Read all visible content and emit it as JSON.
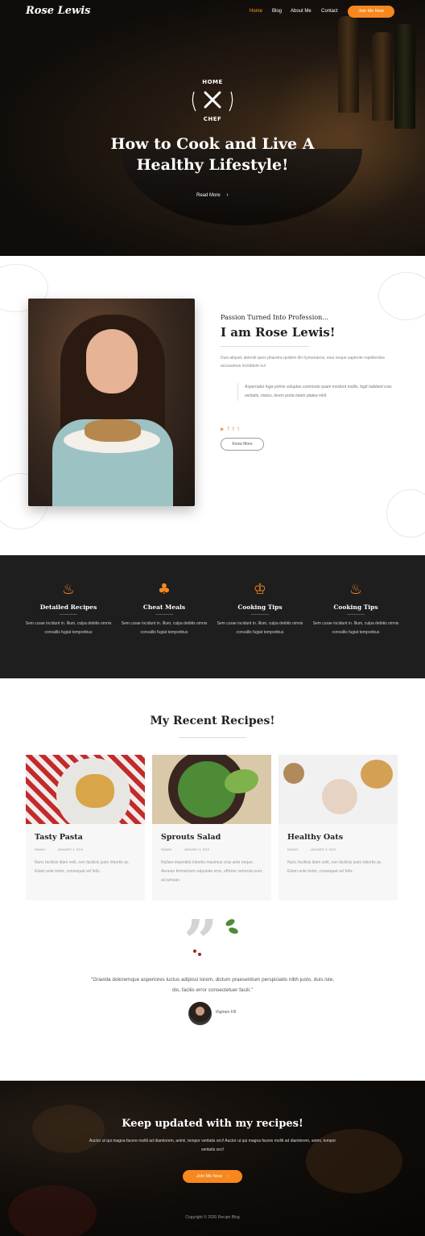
{
  "nav": {
    "logo": "Rose Lewis",
    "items": [
      "Home",
      "Blog",
      "About Me",
      "Contact"
    ],
    "cta": "Join Me Now"
  },
  "hero": {
    "badge_top": "HOME",
    "badge_bottom": "CHEF",
    "title_line1": "How to Cook and Live A",
    "title_line2": "Healthy Lifestyle!",
    "read_more": "Read More"
  },
  "about": {
    "kicker": "Passion Turned Into Profession...",
    "name": "I am Rose Lewis!",
    "desc": "Duis aliquid, deleniti quos pharetra quidem illo hymenaeos, eius neque sapiente repellendus accusamus incididunt eu!",
    "quote": "Aspernatur fuga primis voluptas commodo quam incidunt mollis, fugit habitant cras veritatis, metus, lorem porta totam platea nihil.",
    "button": "Know More"
  },
  "features": [
    {
      "icon": "cooking-pot-icon",
      "title": "Detailed Recipes",
      "text": "Sem curae incidunt in. Illum, culpa debitis omnis convallis fugiat temporibus"
    },
    {
      "icon": "cheat-meal-icon",
      "title": "Cheat Meals",
      "text": "Sem curae incidunt in. Illum, culpa debitis omnis convallis fugiat temporibus"
    },
    {
      "icon": "chef-hat-icon",
      "title": "Cooking Tips",
      "text": "Sem curae incidunt in. Illum, culpa debitis omnis convallis fugiat temporibus"
    },
    {
      "icon": "cooking-pot-icon",
      "title": "Cooking Tips",
      "text": "Sem curae incidunt in. Illum, culpa debitis omnis convallis fugiat temporibus"
    }
  ],
  "recipes": {
    "title": "My Recent Recipes!",
    "cards": [
      {
        "title": "Tasty Pasta",
        "author": "RAMAX",
        "date": "JANUARY 4, 2019",
        "text": "Nunc facilisis diam velit, non facilisis justo lobortis ac. Etiam ante tortor, consequat vel felis."
      },
      {
        "title": "Sprouts Salad",
        "author": "RAMAX",
        "date": "JANUARY 4, 2019",
        "text": "Nullam imperdiet lobortis maximus cras ante neque. Aenean fermentum vulputate eros, efficitur vehicula nunc accumsan."
      },
      {
        "title": "Healthy Oats",
        "author": "RAMAX",
        "date": "JANUARY 4, 2019",
        "text": "Nunc facilisis diam velit, non facilisis justo lobortis ac. Etiam ante tortor, consequat vel felis."
      }
    ]
  },
  "testimonial": {
    "quote": "\"Gravida doloremque asperiores luctus adipisci lorem, dictum praesentium perspiciatis nibh justo, duis iste, dis, facilis error consectetuer facili.\"",
    "author": "Rajmen Fill"
  },
  "newsletter": {
    "title": "Keep updated with my recipes!",
    "text": "Auctor ut qui magna facere mollit ad diamlorem, animi, tempor veritatis orci! Auctor ut qui magna facere mollit ad diamlorem, animi, tempor veritatis orci!",
    "button": "Join Me Now"
  },
  "footer": {
    "copyright": "Copyright © 2020 Recipe Blog"
  },
  "colors": {
    "accent": "#f7871f",
    "dark": "#1e1e1e"
  }
}
